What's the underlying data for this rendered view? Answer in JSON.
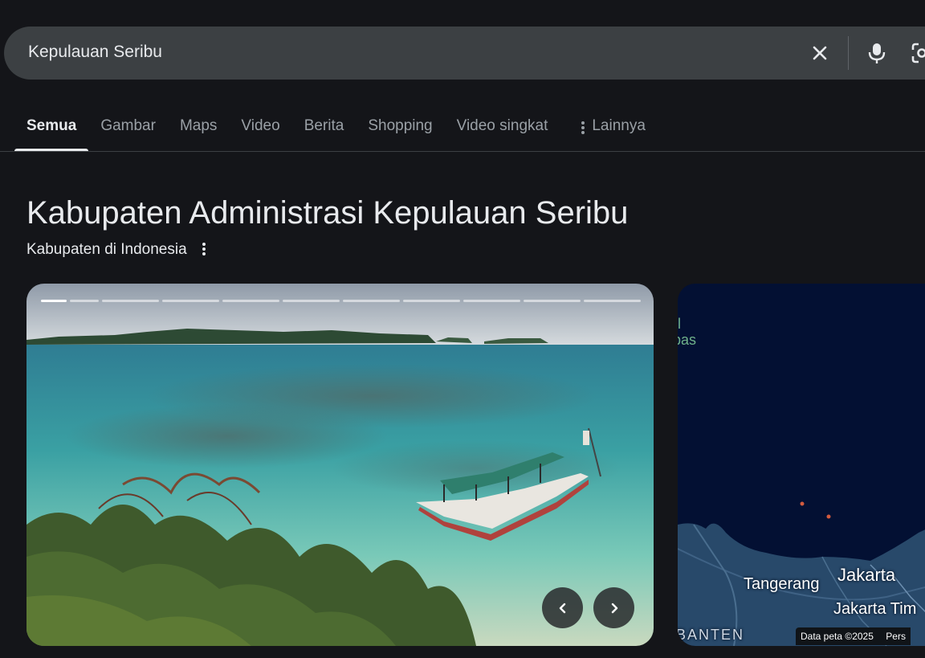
{
  "search": {
    "query": "Kepulauan Seribu"
  },
  "icons": {
    "clear": "close-icon",
    "mic": "microphone-icon",
    "lens": "camera-lens-icon"
  },
  "tabs": [
    {
      "label": "Semua",
      "active": true
    },
    {
      "label": "Gambar",
      "active": false
    },
    {
      "label": "Maps",
      "active": false
    },
    {
      "label": "Video",
      "active": false
    },
    {
      "label": "Berita",
      "active": false
    },
    {
      "label": "Shopping",
      "active": false
    },
    {
      "label": "Video singkat",
      "active": false
    },
    {
      "label": "Lainnya",
      "active": false
    }
  ],
  "knowledge_panel": {
    "title": "Kabupaten Administrasi Kepulauan Seribu",
    "subtitle": "Kabupaten di Indonesia"
  },
  "carousel": {
    "segments": 10,
    "current": 1
  },
  "map": {
    "green_label_1": "l",
    "green_label_2": "bas",
    "tangerang": "Tangerang",
    "jakarta": "Jakarta",
    "jakarta_timur": "Jakarta Tim",
    "banten": "BANTEN",
    "attribution": "Data peta ©2025",
    "terms": "Pers"
  },
  "colors": {
    "background": "#141519",
    "searchbar": "#3c4043",
    "accent_text": "#e8eaed",
    "muted_text": "#9aa0a6",
    "map_sea": "#031033"
  }
}
